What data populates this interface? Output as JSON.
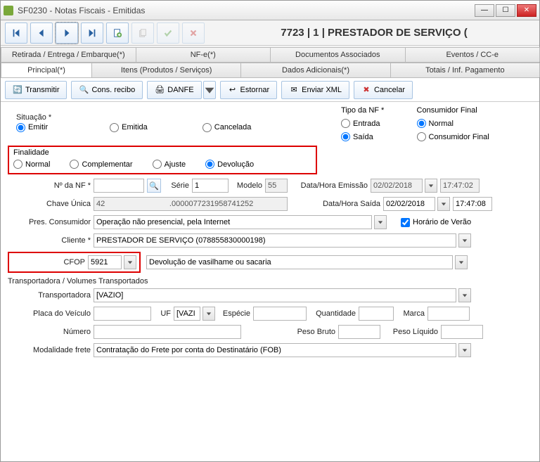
{
  "title": "SF0230 - Notas Fiscais - Emitidas",
  "info_line": "7723  |  1  |  PRESTADOR DE SERVIÇO (",
  "tabs_top": {
    "retirada": "Retirada / Entrega / Embarque(*)",
    "nfe": "NF-e(*)",
    "docs": "Documentos Associados",
    "eventos": "Eventos / CC-e"
  },
  "tabs_main": {
    "principal": "Principal(*)",
    "itens": "Itens (Produtos / Serviços)",
    "dados": "Dados Adicionais(*)",
    "totais": "Totais / Inf. Pagamento"
  },
  "toolbar": {
    "transmitir": "Transmitir",
    "cons_recibo": "Cons. recibo",
    "danfe": "DANFE",
    "estornar": "Estornar",
    "enviar_xml": "Enviar XML",
    "cancelar": "Cancelar"
  },
  "labels": {
    "situacao": "Situação *",
    "tipo_nf": "Tipo da NF *",
    "consumidor_final": "Consumidor Final",
    "finalidade": "Finalidade",
    "n_nf": "Nº da NF *",
    "serie": "Série",
    "modelo": "Modelo",
    "data_hora_emissao": "Data/Hora Emissão",
    "chave_unica": "Chave Única",
    "data_hora_saida": "Data/Hora Saída",
    "pres_consumidor": "Pres. Consumidor",
    "horario_verao": "Horário de Verão",
    "cliente": "Cliente *",
    "cfop": "CFOP",
    "transportadora_section": "Transportadora / Volumes Transportados",
    "transportadora": "Transportadora",
    "placa": "Placa do Veículo",
    "uf": "UF",
    "especie": "Espécie",
    "quantidade": "Quantidade",
    "marca": "Marca",
    "numero": "Número",
    "peso_bruto": "Peso Bruto",
    "peso_liquido": "Peso Líquido",
    "modalidade": "Modalidade frete"
  },
  "radios": {
    "situacao": {
      "emitir": "Emitir",
      "emitida": "Emitida",
      "cancelada": "Cancelada"
    },
    "tipo_nf": {
      "entrada": "Entrada",
      "saida": "Saída"
    },
    "consumidor": {
      "normal": "Normal",
      "final": "Consumidor Final"
    },
    "finalidade": {
      "normal": "Normal",
      "complementar": "Complementar",
      "ajuste": "Ajuste",
      "devolucao": "Devolução"
    }
  },
  "values": {
    "n_nf": "",
    "serie": "1",
    "modelo": "55",
    "data_emissao": "02/02/2018",
    "hora_emissao": "17:47:02",
    "chave": "42                              .0000077231958741252",
    "data_saida": "02/02/2018",
    "hora_saida": "17:47:08",
    "pres_consumidor": "Operação não presencial, pela Internet",
    "cliente": "PRESTADOR DE SERVIÇO (078855830000198)",
    "cfop": "5921",
    "cfop_desc": "Devolução de vasilhame ou sacaria",
    "transportadora": "[VAZIO]",
    "placa": "",
    "uf": "[VAZI",
    "especie": "",
    "quantidade": "",
    "marca": "",
    "numero": "",
    "peso_bruto": "",
    "peso_liquido": "",
    "modalidade": "Contratação do Frete por conta do Destinatário (FOB)"
  }
}
